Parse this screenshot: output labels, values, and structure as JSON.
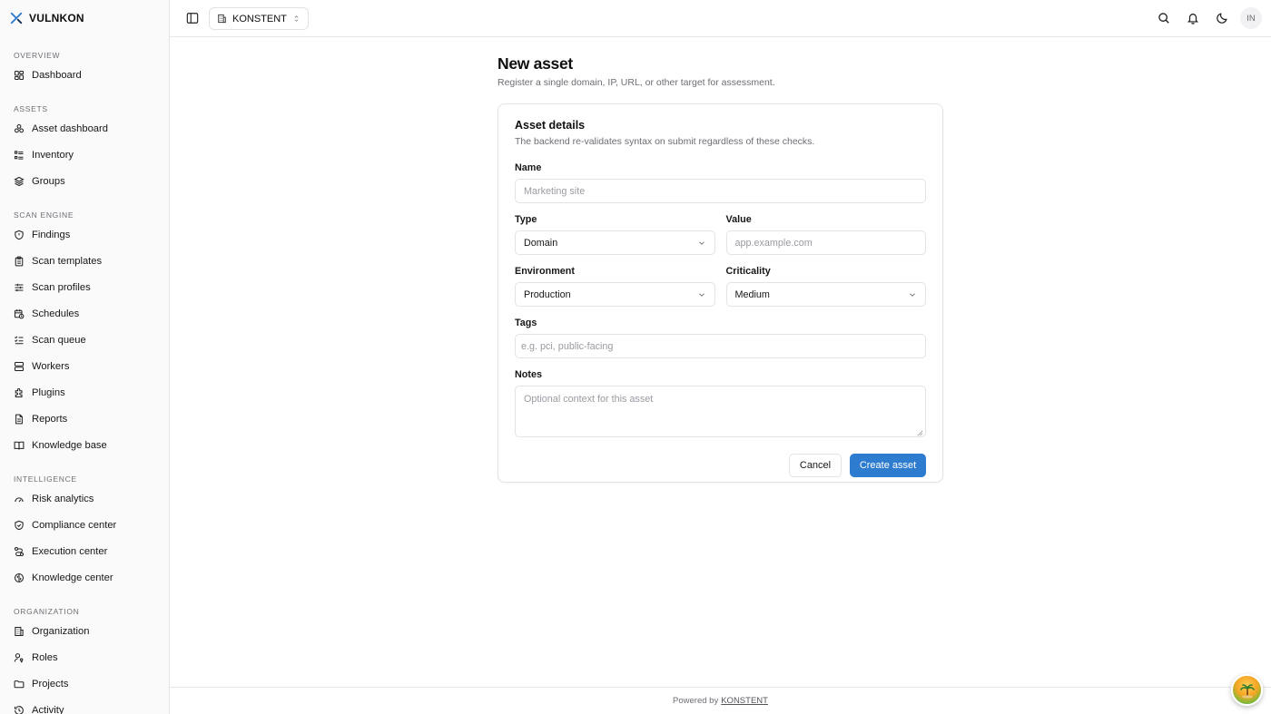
{
  "brand": {
    "name": "VULNKON",
    "logo_icon": "vulnkon-logo-icon"
  },
  "sidebar": {
    "sections": [
      {
        "title": "OVERVIEW",
        "items": [
          {
            "label": "Dashboard",
            "icon": "dashboard-icon"
          }
        ]
      },
      {
        "title": "ASSETS",
        "items": [
          {
            "label": "Asset dashboard",
            "icon": "asset-cluster-icon"
          },
          {
            "label": "Inventory",
            "icon": "inventory-list-icon"
          },
          {
            "label": "Groups",
            "icon": "layers-icon"
          }
        ]
      },
      {
        "title": "SCAN ENGINE",
        "items": [
          {
            "label": "Findings",
            "icon": "shield-icon"
          },
          {
            "label": "Scan templates",
            "icon": "clipboard-icon"
          },
          {
            "label": "Scan profiles",
            "icon": "sliders-icon"
          },
          {
            "label": "Schedules",
            "icon": "calendar-clock-icon"
          },
          {
            "label": "Scan queue",
            "icon": "checklist-icon"
          },
          {
            "label": "Workers",
            "icon": "server-icon"
          },
          {
            "label": "Plugins",
            "icon": "puzzle-icon"
          },
          {
            "label": "Reports",
            "icon": "file-text-icon"
          },
          {
            "label": "Knowledge base",
            "icon": "book-open-icon"
          }
        ]
      },
      {
        "title": "INTELLIGENCE",
        "items": [
          {
            "label": "Risk analytics",
            "icon": "gauge-icon"
          },
          {
            "label": "Compliance center",
            "icon": "shield-check-icon"
          },
          {
            "label": "Execution center",
            "icon": "route-icon"
          },
          {
            "label": "Knowledge center",
            "icon": "brain-icon"
          }
        ]
      },
      {
        "title": "ORGANIZATION",
        "items": [
          {
            "label": "Organization",
            "icon": "building-icon"
          },
          {
            "label": "Roles",
            "icon": "user-key-icon"
          },
          {
            "label": "Projects",
            "icon": "folder-icon"
          },
          {
            "label": "Activity",
            "icon": "history-icon"
          }
        ]
      }
    ]
  },
  "topbar": {
    "org_name": "KONSTENT",
    "avatar_initials": "IN"
  },
  "page": {
    "title": "New asset",
    "subtitle": "Register a single domain, IP, URL, or other target for assessment."
  },
  "form": {
    "card_title": "Asset details",
    "card_description": "The backend re-validates syntax on submit regardless of these checks.",
    "name": {
      "label": "Name",
      "placeholder": "Marketing site"
    },
    "type": {
      "label": "Type",
      "value": "Domain"
    },
    "value": {
      "label": "Value",
      "placeholder": "app.example.com"
    },
    "environment": {
      "label": "Environment",
      "value": "Production"
    },
    "criticality": {
      "label": "Criticality",
      "value": "Medium"
    },
    "tags": {
      "label": "Tags",
      "placeholder": "e.g. pci, public-facing"
    },
    "notes": {
      "label": "Notes",
      "placeholder": "Optional context for this asset"
    },
    "cancel_label": "Cancel",
    "submit_label": "Create asset"
  },
  "footer": {
    "prefix": "Powered by",
    "link": "KONSTENT"
  },
  "colors": {
    "primary": "#2e7ccf",
    "border": "#e3e3e6",
    "muted_text": "#6d6d74",
    "brand_icon": "#2e7ccf"
  }
}
